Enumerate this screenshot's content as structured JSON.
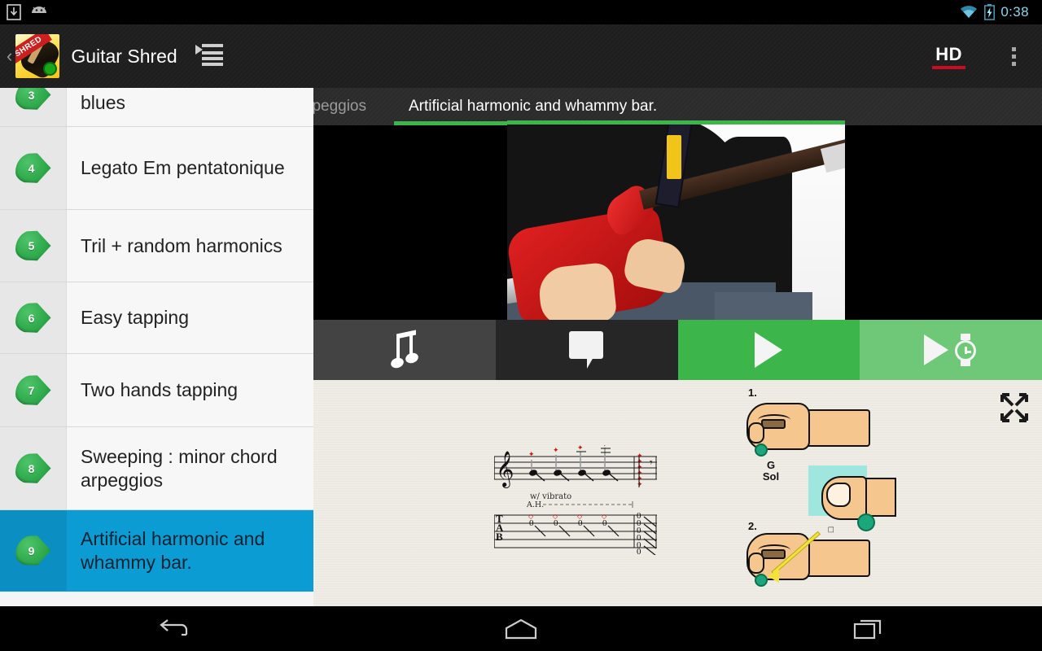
{
  "statusbar": {
    "time": "0:38",
    "icons": [
      "download-icon",
      "android-icon",
      "wifi-icon",
      "battery-charging-icon"
    ]
  },
  "actionbar": {
    "back_caret": "‹",
    "app_title": "Guitar Shred",
    "app_icon_text": "SHRED",
    "list_menu_icon": "list-menu-icon",
    "hd_label": "HD",
    "overflow_icon": "overflow-menu-icon"
  },
  "sidebar": {
    "items": [
      {
        "num": "3",
        "label": "blues",
        "selected": false,
        "partial": true
      },
      {
        "num": "4",
        "label": "Legato Em pentatonique",
        "selected": false
      },
      {
        "num": "5",
        "label": "Tril + random harmonics",
        "selected": false
      },
      {
        "num": "6",
        "label": "Easy tapping",
        "selected": false
      },
      {
        "num": "7",
        "label": "Two hands tapping",
        "selected": false
      },
      {
        "num": "8",
        "label": "Sweeping : minor chord arpeggios",
        "selected": false
      },
      {
        "num": "9",
        "label": "Artificial harmonic and whammy bar.",
        "selected": true
      }
    ],
    "selected_color": "#0c9cd4",
    "pick_color": "#2faa4c"
  },
  "content": {
    "tabs": [
      {
        "label": "nor chord arpeggios",
        "active": false
      },
      {
        "label": "Artificial harmonic and whammy bar.",
        "active": true
      }
    ],
    "accent_color": "#3cb54a",
    "video": {
      "name": "lesson-video-thumbnail",
      "description": "Guitarist playing red electric guitar"
    },
    "buttons": [
      {
        "name": "music-note-button",
        "icon": "music-note-icon",
        "bg": "#434343"
      },
      {
        "name": "comment-button",
        "icon": "speech-bubble-icon",
        "bg": "#262626"
      },
      {
        "name": "play-button",
        "icon": "play-icon",
        "bg": "#3cb54a"
      },
      {
        "name": "play-slow-button",
        "icon": "play-slow-motion-icon",
        "bg": "#6ec877"
      }
    ],
    "score": {
      "expand_icon": "fullscreen-expand-icon",
      "tab_letters": [
        "T",
        "A",
        "B"
      ],
      "annotations": [
        "w/ vibrato",
        "A.H."
      ],
      "tab_numbers": [
        "0",
        "0",
        "0",
        "0"
      ],
      "chord_numbers": [
        "0",
        "0",
        "0",
        "0",
        "0",
        "0"
      ]
    },
    "diagram": {
      "step1": "1.",
      "step2": "2.",
      "note_letter": "G",
      "note_solfege": "Sol"
    }
  },
  "navbar": {
    "back": "back-icon",
    "home": "home-icon",
    "recents": "recents-icon"
  }
}
